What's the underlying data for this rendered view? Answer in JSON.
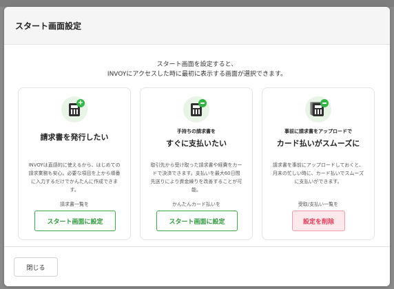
{
  "modal": {
    "title": "スタート画面設定",
    "intro_line1": "スタート画面を設定すると、",
    "intro_line2": "INVOYにアクセスした時に最初に表示する画面が選択できます。",
    "close_label": "閉じる"
  },
  "cards": [
    {
      "icon": "invoice-plus-icon",
      "title": "請求書を発行したい",
      "description": "INVOYは直感的に使えるから、はじめての請求業務も安心。必要な項目を上から順番に入力するだけでかんたんに作成できます。",
      "caption": "請求書一覧を",
      "button": "スタート画面に設定"
    },
    {
      "icon": "invoice-minus-icon",
      "subtitle": "手持ちの請求書を",
      "title": "すぐに支払いたい",
      "description": "取引先から受け取った請求書や経費をカードで決済できます。支払いを最大60日間先送りにより資金繰りを改善することが可能。",
      "caption": "かんたんカード払いを",
      "button": "スタート画面に設定"
    },
    {
      "icon": "invoice-stack-icon",
      "subtitle": "事前に請求書をアップロードで",
      "title": "カード払いがスムーズに",
      "description": "請求書を事前にアップロードしておくと、月末の忙しい時に、カード払いでスムーズに支払いができます。",
      "caption": "受取/支払い一覧を",
      "button": "設定を削除"
    }
  ],
  "colors": {
    "accent_green": "#36b44a",
    "danger": "#e23b5a"
  }
}
